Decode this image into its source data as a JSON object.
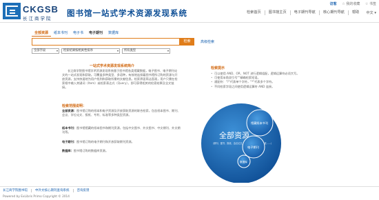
{
  "header": {
    "brand_en": "CKGSB",
    "brand_cn": "长江商学院",
    "system_title": "图书馆一站式学术资源发现系统",
    "guest": "访客",
    "favorites": "☆ 我的收藏",
    "bookmarks": "☆ 书签",
    "nav": [
      "检索首页",
      "图书馆主页",
      "电子期刊导航",
      "核心期刊导航",
      "帮助"
    ],
    "language": "中文"
  },
  "search": {
    "tabs": [
      "全部资源",
      "纸本书刊",
      "电子书",
      "电子期刊",
      "数据库"
    ],
    "query": "",
    "button": "检索",
    "advanced": "高级检索",
    "select_field": "全部字段",
    "select_sort": "检索结果按相关性排序",
    "select_type": "所有类型"
  },
  "intro": {
    "title": "一站式学术资源发现系统简介",
    "text": "长江商学院图书馆学术资源发现系统基于图书馆各类馆藏数据，电子图书、电子期刊论文的一站式发现和获取。可覆盖多种类型、多语种，有效地连接着图书馆所订购的资源与开放资源，支持快速地为用户找到和获取所需的文献信息。检索界面简洁直观，用户只需在检索框中输入关键词（Item）或检索表达式（Query），即可获得相关的检索结果及全文链接。"
  },
  "usage": {
    "title": "检索范围说明：",
    "items": [
      {
        "label": "全部资源：",
        "text": "图书馆订购的纸本和电子资源及开放获取资源的联合检索，包含纸本图书、期刊、会议、学位论文、报纸、专利、标准等多种类型资源。"
      },
      {
        "label": "纸本书刊：",
        "text": "图书馆馆藏的纸本图书和期刊资源，包括中文图书、外文图书、中文期刊、外文期刊等。"
      },
      {
        "label": "电子期刊：",
        "text": "图书馆订购的电子期刊和开放获取期刊资源。"
      },
      {
        "label": "数据库：",
        "text": "图书馆订购的数据库资源。"
      }
    ]
  },
  "tips": {
    "title": "检索提示",
    "items": [
      "可以使用 AND、OR、NOT 进行逻辑组配，逻辑运算符必须大写。",
      "可使用半角双引号\"\"精确检索短语。",
      "通配符：\"?\"代表单个字符，\"*\"代表多个字符。",
      "不同检索字段之间使用逻辑运算符 AND 连接。"
    ]
  },
  "diagram": {
    "main_label": "全部资源",
    "main_sub": "（期刊、图书、报纸、会议论文、学位论文、专利、标准……）",
    "circle_print": "馆藏纸本书刊",
    "circle_ejournal": "电子期刊",
    "circle_db": "数据库"
  },
  "footer": {
    "links": [
      "长江商学院图书馆",
      "中外文核心期刊查询系统",
      "咨询反馈"
    ],
    "copyright": "Powered by ExLibris Primo   Copyright © 2014"
  },
  "colors": {
    "brand_blue": "#1d6fb8",
    "accent_orange": "#e07d1a",
    "link_blue": "#1a62b0"
  }
}
